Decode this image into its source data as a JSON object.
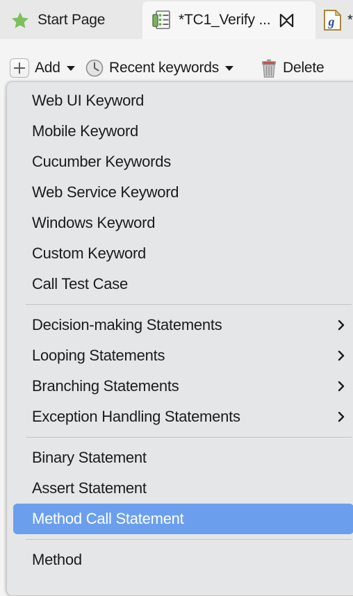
{
  "tabs": [
    {
      "id": "start-page",
      "label": "Start Page",
      "icon": "star-icon",
      "active": false
    },
    {
      "id": "tc1",
      "label": "*TC1_Verify ...",
      "icon": "test-case-icon",
      "active": true,
      "close_icon": "close-icon",
      "modified": true
    },
    {
      "id": "groovy",
      "label": "*",
      "icon": "groovy-file-icon",
      "active": false
    }
  ],
  "toolbar": {
    "add_label": "Add",
    "add_icon": "plus-icon",
    "recent_label": "Recent keywords",
    "recent_icon": "clock-icon",
    "delete_label": "Delete",
    "delete_icon": "trash-icon",
    "edge_button_icon": "up-arrow-icon"
  },
  "menu": {
    "groups": [
      {
        "items": [
          {
            "label": "Web UI Keyword",
            "submenu": false,
            "selected": false
          },
          {
            "label": "Mobile Keyword",
            "submenu": false,
            "selected": false
          },
          {
            "label": "Cucumber Keywords",
            "submenu": false,
            "selected": false
          },
          {
            "label": "Web Service Keyword",
            "submenu": false,
            "selected": false
          },
          {
            "label": "Windows Keyword",
            "submenu": false,
            "selected": false
          },
          {
            "label": "Custom Keyword",
            "submenu": false,
            "selected": false
          },
          {
            "label": "Call Test Case",
            "submenu": false,
            "selected": false
          }
        ]
      },
      {
        "items": [
          {
            "label": "Decision-making Statements",
            "submenu": true,
            "selected": false
          },
          {
            "label": "Looping Statements",
            "submenu": true,
            "selected": false
          },
          {
            "label": "Branching Statements",
            "submenu": true,
            "selected": false
          },
          {
            "label": "Exception Handling Statements",
            "submenu": true,
            "selected": false
          }
        ]
      },
      {
        "items": [
          {
            "label": "Binary Statement",
            "submenu": false,
            "selected": false
          },
          {
            "label": "Assert Statement",
            "submenu": false,
            "selected": false
          },
          {
            "label": "Method Call Statement",
            "submenu": false,
            "selected": true
          }
        ]
      },
      {
        "items": [
          {
            "label": "Method",
            "submenu": false,
            "selected": false
          }
        ]
      }
    ]
  },
  "colors": {
    "highlight": "#6b9fee",
    "menu_background": "#e5e6e8",
    "tabbar_background": "#e8e8e8",
    "toolbar_background": "#f4f4f4",
    "star": "#7dbf5c",
    "trash_lid": "#d33a36",
    "groovy_border": "#a8873a"
  }
}
